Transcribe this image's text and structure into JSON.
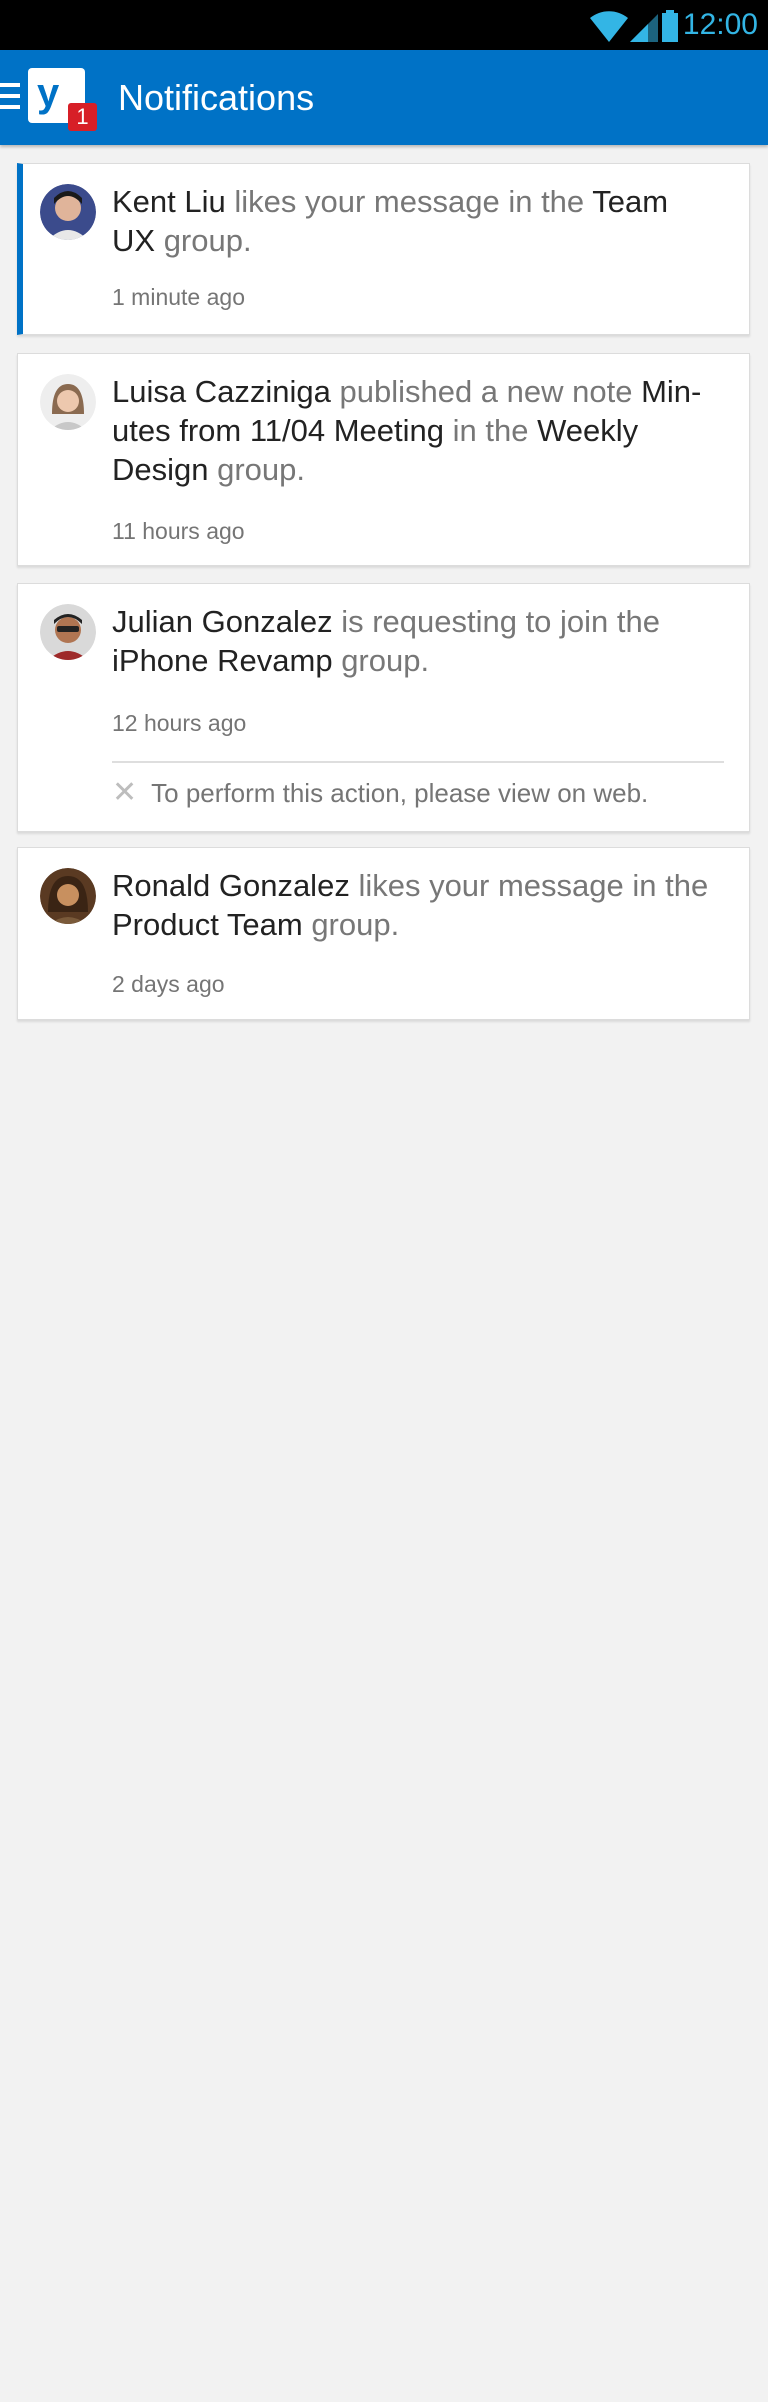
{
  "status_bar": {
    "time": "12:00",
    "icons": [
      "wifi-icon",
      "signal-icon",
      "battery-icon"
    ]
  },
  "app_bar": {
    "logo_letter": "y",
    "badge_count": "1",
    "title": "Notifications"
  },
  "notifications": [
    {
      "actor": "Kent Liu",
      "text1": " likes your message in the ",
      "target": "Team UX",
      "text2": " group.",
      "time": "1 minute ago",
      "unread": true
    },
    {
      "actor": "Luisa Cazziniga",
      "text1": " published a new note ",
      "target": "Min-utes from 11/04 Meeting",
      "text2": " in the ",
      "target2": "Weekly Design",
      "text3": " group.",
      "time": "11 hours ago",
      "unread": false
    },
    {
      "actor": "Julian Gonzalez",
      "text1": " is requesting to join the ",
      "target": "iPhone Revamp",
      "text2": " group.",
      "time": "12 hours ago",
      "action_note": "To perform this action, please view on web.",
      "unread": false
    },
    {
      "actor": "Ronald Gonzalez",
      "text1": " likes your message in the ",
      "target": "Product Team",
      "text2": " group.",
      "time": "2 days ago",
      "unread": false
    }
  ],
  "colors": {
    "app_bar": "#0072c6",
    "status_accent": "#33b5e5",
    "badge": "#d71f27",
    "unread_marker": "#0072c6",
    "background": "#f2f2f2"
  }
}
